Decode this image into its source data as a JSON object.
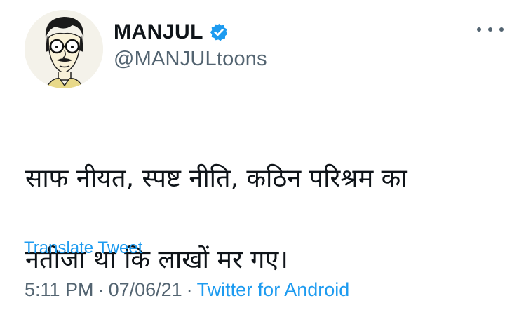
{
  "tweet": {
    "author": {
      "display_name": "MANJUL",
      "handle": "@MANJULtoons",
      "verified": true,
      "avatar": "caricature-avatar"
    },
    "more_icon": "more-horizontal-icon",
    "text_lines": [
      "साफ नीयत, स्पष्ट नीति, कठिन परिश्रम का",
      "नतीजा था कि लाखों मर गए।"
    ],
    "translate_label": "Translate Tweet",
    "time": "5:11 PM",
    "date": "07/06/21",
    "source": "Twitter for Android",
    "separator": "·"
  },
  "colors": {
    "text_primary": "#0f1419",
    "text_secondary": "#536471",
    "link": "#1d9bf0",
    "verified_badge": "#1d9bf0",
    "background": "#ffffff"
  }
}
